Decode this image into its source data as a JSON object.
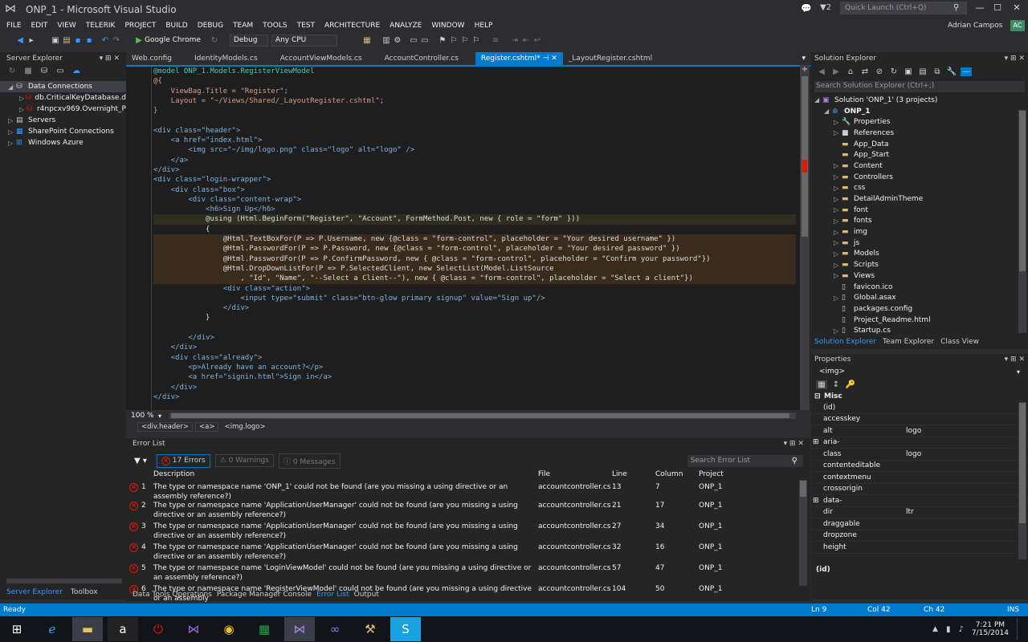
{
  "window": {
    "title": "ONP_1 - Microsoft Visual Studio",
    "notifications_count": "2",
    "quick_launch_placeholder": "Quick Launch (Ctrl+Q)"
  },
  "menu": [
    "FILE",
    "EDIT",
    "VIEW",
    "TELERIK",
    "PROJECT",
    "BUILD",
    "DEBUG",
    "TEAM",
    "TOOLS",
    "TEST",
    "ARCHITECTURE",
    "ANALYZE",
    "WINDOW",
    "HELP"
  ],
  "user": {
    "name": "Adrian Campos",
    "initials": "AC"
  },
  "toolbar": {
    "browser": "Google Chrome",
    "config": "Debug",
    "platform": "Any CPU"
  },
  "server_explorer": {
    "title": "Server Explorer",
    "items": [
      {
        "label": "Data Connections",
        "level": 0,
        "expanded": true
      },
      {
        "label": "db.CriticalKeyDatabase.d",
        "level": 1
      },
      {
        "label": "r4npcxv969.Overnight_P",
        "level": 1
      },
      {
        "label": "Servers",
        "level": 0
      },
      {
        "label": "SharePoint Connections",
        "level": 0
      },
      {
        "label": "Windows Azure",
        "level": 0
      }
    ],
    "bottom_tabs": [
      "Server Explorer",
      "Toolbox"
    ]
  },
  "editor": {
    "tabs": [
      "Web.config",
      "IdentityModels.cs",
      "AccountViewModels.cs",
      "AccountController.cs",
      "Register.cshtml*",
      "_LayoutRegister.cshtml"
    ],
    "active_tab": 4,
    "zoom": "100 %",
    "breadcrumb": [
      "<div.header>",
      "<a>",
      "<img.logo>"
    ]
  },
  "code": [
    "@model ONP_1.Models.RegisterViewModel",
    "@{",
    "    ViewBag.Title = \"Register\";",
    "    Layout = \"~/Views/Shared/_LayoutRegister.cshtml\";",
    "}",
    "",
    "<div class=\"header\">",
    "    <a href=\"index.html\">",
    "        <img src=\"~/img/logo.png\" class=\"logo\" alt=\"logo\" />",
    "    </a>",
    "</div>",
    "<div class=\"login-wrapper\">",
    "    <div class=\"box\">",
    "        <div class=\"content-wrap\">",
    "            <h6>Sign Up</h6>",
    "            @using (Html.BeginForm(\"Register\", \"Account\", FormMethod.Post, new { role = \"form\" }))",
    "            {",
    "                @Html.TextBoxFor(P => P.Username, new {@class = \"form-control\", placeholder = \"Your desired username\" })",
    "                @Html.PasswordFor(P => P.Password, new {@class = \"form-control\", placeholder = \"Your desired password\" })",
    "                @Html.PasswordFor(P => P.ConfirmPassword, new { @class = \"form-control\", placeholder = \"Confirm your password\"})",
    "                @Html.DropDownListFor(P => P.SelectedClient, new SelectList(Model.ListSource",
    "                    , \"Id\", \"Name\", \"--Select a Client--\"), new { @class = \"form-control\", placeholder = \"Select a client\"})",
    "                <div class=\"action\">",
    "                    <input type=\"submit\" class=\"btn-glow primary signup\" value=\"Sign up\"/>",
    "                </div>",
    "            }",
    "",
    "        </div>",
    "    </div>",
    "    <div class=\"already\">",
    "        <p>Already have an account?</p>",
    "        <a href=\"signin.html\">Sign in</a>",
    "    </div>",
    "</div>",
    ""
  ],
  "error_list": {
    "title": "Error List",
    "errors_btn": "17 Errors",
    "warnings_btn": "0 Warnings",
    "messages_btn": "0 Messages",
    "search_placeholder": "Search Error List",
    "headers": [
      "Description",
      "File",
      "Line",
      "Column",
      "Project"
    ],
    "rows": [
      {
        "n": "1",
        "desc": "The type or namespace name 'ONP_1' could not be found (are you missing a using directive or an assembly reference?)",
        "file": "accountcontroller.cs",
        "line": "13",
        "col": "7",
        "proj": "ONP_1"
      },
      {
        "n": "2",
        "desc": "The type or namespace name 'ApplicationUserManager' could not be found (are you missing a using directive or an assembly reference?)",
        "file": "accountcontroller.cs",
        "line": "21",
        "col": "17",
        "proj": "ONP_1"
      },
      {
        "n": "3",
        "desc": "The type or namespace name 'ApplicationUserManager' could not be found (are you missing a using directive or an assembly reference?)",
        "file": "accountcontroller.cs",
        "line": "27",
        "col": "34",
        "proj": "ONP_1"
      },
      {
        "n": "4",
        "desc": "The type or namespace name 'ApplicationUserManager' could not be found (are you missing a using directive or an assembly reference?)",
        "file": "accountcontroller.cs",
        "line": "32",
        "col": "16",
        "proj": "ONP_1"
      },
      {
        "n": "5",
        "desc": "The type or namespace name 'LoginViewModel' could not be found (are you missing a using directive or an assembly reference?)",
        "file": "accountcontroller.cs",
        "line": "57",
        "col": "47",
        "proj": "ONP_1"
      },
      {
        "n": "6",
        "desc": "The type or namespace name 'RegisterViewModel' could not be found (are you missing a using directive or an assembly",
        "file": "accountcontroller.cs",
        "line": "104",
        "col": "50",
        "proj": "ONP_1"
      }
    ],
    "bottom_tabs": [
      "Data Tools Operations",
      "Package Manager Console",
      "Error List",
      "Output"
    ]
  },
  "solution_explorer": {
    "title": "Solution Explorer",
    "search_placeholder": "Search Solution Explorer (Ctrl+;)",
    "items": [
      {
        "label": "Solution 'ONP_1' (3 projects)",
        "level": 0,
        "icon": "solution"
      },
      {
        "label": "ONP_1",
        "level": 1,
        "icon": "project",
        "bold": true
      },
      {
        "label": "Properties",
        "level": 2,
        "icon": "wrench"
      },
      {
        "label": "References",
        "level": 2,
        "icon": "refs"
      },
      {
        "label": "App_Data",
        "level": 2,
        "icon": "folder"
      },
      {
        "label": "App_Start",
        "level": 2,
        "icon": "folder"
      },
      {
        "label": "Content",
        "level": 2,
        "icon": "folder"
      },
      {
        "label": "Controllers",
        "level": 2,
        "icon": "folder"
      },
      {
        "label": "css",
        "level": 2,
        "icon": "folder"
      },
      {
        "label": "DetailAdminTheme",
        "level": 2,
        "icon": "folder"
      },
      {
        "label": "font",
        "level": 2,
        "icon": "folder"
      },
      {
        "label": "fonts",
        "level": 2,
        "icon": "folder"
      },
      {
        "label": "img",
        "level": 2,
        "icon": "folder"
      },
      {
        "label": "js",
        "level": 2,
        "icon": "folder"
      },
      {
        "label": "Models",
        "level": 2,
        "icon": "folder"
      },
      {
        "label": "Scripts",
        "level": 2,
        "icon": "folder"
      },
      {
        "label": "Views",
        "level": 2,
        "icon": "folder"
      },
      {
        "label": "favicon.ico",
        "level": 2,
        "icon": "file"
      },
      {
        "label": "Global.asax",
        "level": 2,
        "icon": "file"
      },
      {
        "label": "packages.config",
        "level": 2,
        "icon": "file"
      },
      {
        "label": "Project_Readme.html",
        "level": 2,
        "icon": "file"
      },
      {
        "label": "Startup.cs",
        "level": 2,
        "icon": "file"
      }
    ],
    "bottom_tabs": [
      "Solution Explorer",
      "Team Explorer",
      "Class View"
    ]
  },
  "properties": {
    "title": "Properties",
    "selected": "<img>",
    "category": "Misc",
    "rows": [
      {
        "name": "(id)",
        "value": ""
      },
      {
        "name": "accesskey",
        "value": ""
      },
      {
        "name": "alt",
        "value": "logo"
      },
      {
        "name": "aria-",
        "value": ""
      },
      {
        "name": "class",
        "value": "logo"
      },
      {
        "name": "contenteditable",
        "value": ""
      },
      {
        "name": "contextmenu",
        "value": ""
      },
      {
        "name": "crossorigin",
        "value": ""
      },
      {
        "name": "data-",
        "value": ""
      },
      {
        "name": "dir",
        "value": "ltr"
      },
      {
        "name": "draggable",
        "value": ""
      },
      {
        "name": "dropzone",
        "value": ""
      },
      {
        "name": "height",
        "value": ""
      }
    ],
    "footer": "(id)"
  },
  "statusbar": {
    "ready": "Ready",
    "ln": "Ln 9",
    "col": "Col 42",
    "ch": "Ch 42",
    "ins": "INS"
  },
  "taskbar": {
    "time": "7:21 PM",
    "date": "7/15/2014"
  },
  "colors": {
    "accent": "#007acc",
    "error": "#e51400",
    "background": "#2d2d30"
  }
}
